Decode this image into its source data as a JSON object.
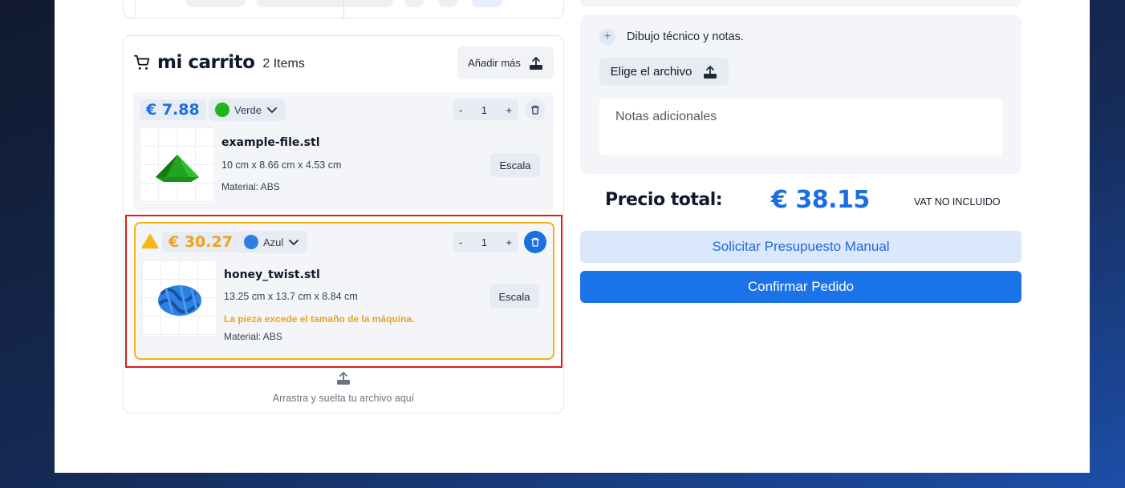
{
  "cart": {
    "title": "mi carrito",
    "count": "2 Items",
    "add_more": "Añadir más",
    "items": [
      {
        "price": "€ 7.88",
        "color": "Verde",
        "color_hex": "#1fb51f",
        "quantity": "1",
        "minus": "-",
        "plus": "+",
        "filename": "example-file.stl",
        "dimensions": "10 cm x 8.66 cm x 4.53 cm",
        "material": "Material: ABS",
        "scale_label": "Escala",
        "warning": null
      },
      {
        "price": "€ 30.27",
        "color": "Azul",
        "color_hex": "#2d7fe0",
        "quantity": "1",
        "minus": "-",
        "plus": "+",
        "filename": "honey_twist.stl",
        "dimensions": "13.25 cm x 13.7 cm x 8.84 cm",
        "material": "Material: ABS",
        "scale_label": "Escala",
        "warning": "La pieza excede el tamaño de la máquina."
      }
    ],
    "dropzone_label": "Arrastra y suelta tu archivo aquí"
  },
  "notes": {
    "heading": "Dibujo técnico y notas.",
    "file_button": "Elige el archivo",
    "placeholder": "Notas adicionales"
  },
  "summary": {
    "total_label": "Precio total:",
    "total_value": "€ 38.15",
    "vat": "VAT NO INCLUIDO",
    "manual_quote": "Solicitar Presupuesto Manual",
    "confirm": "Confirmar Pedido"
  },
  "colors": {
    "accent": "#1a73e8",
    "warning": "#f0a21a",
    "highlight_outline": "#e01b1b"
  }
}
